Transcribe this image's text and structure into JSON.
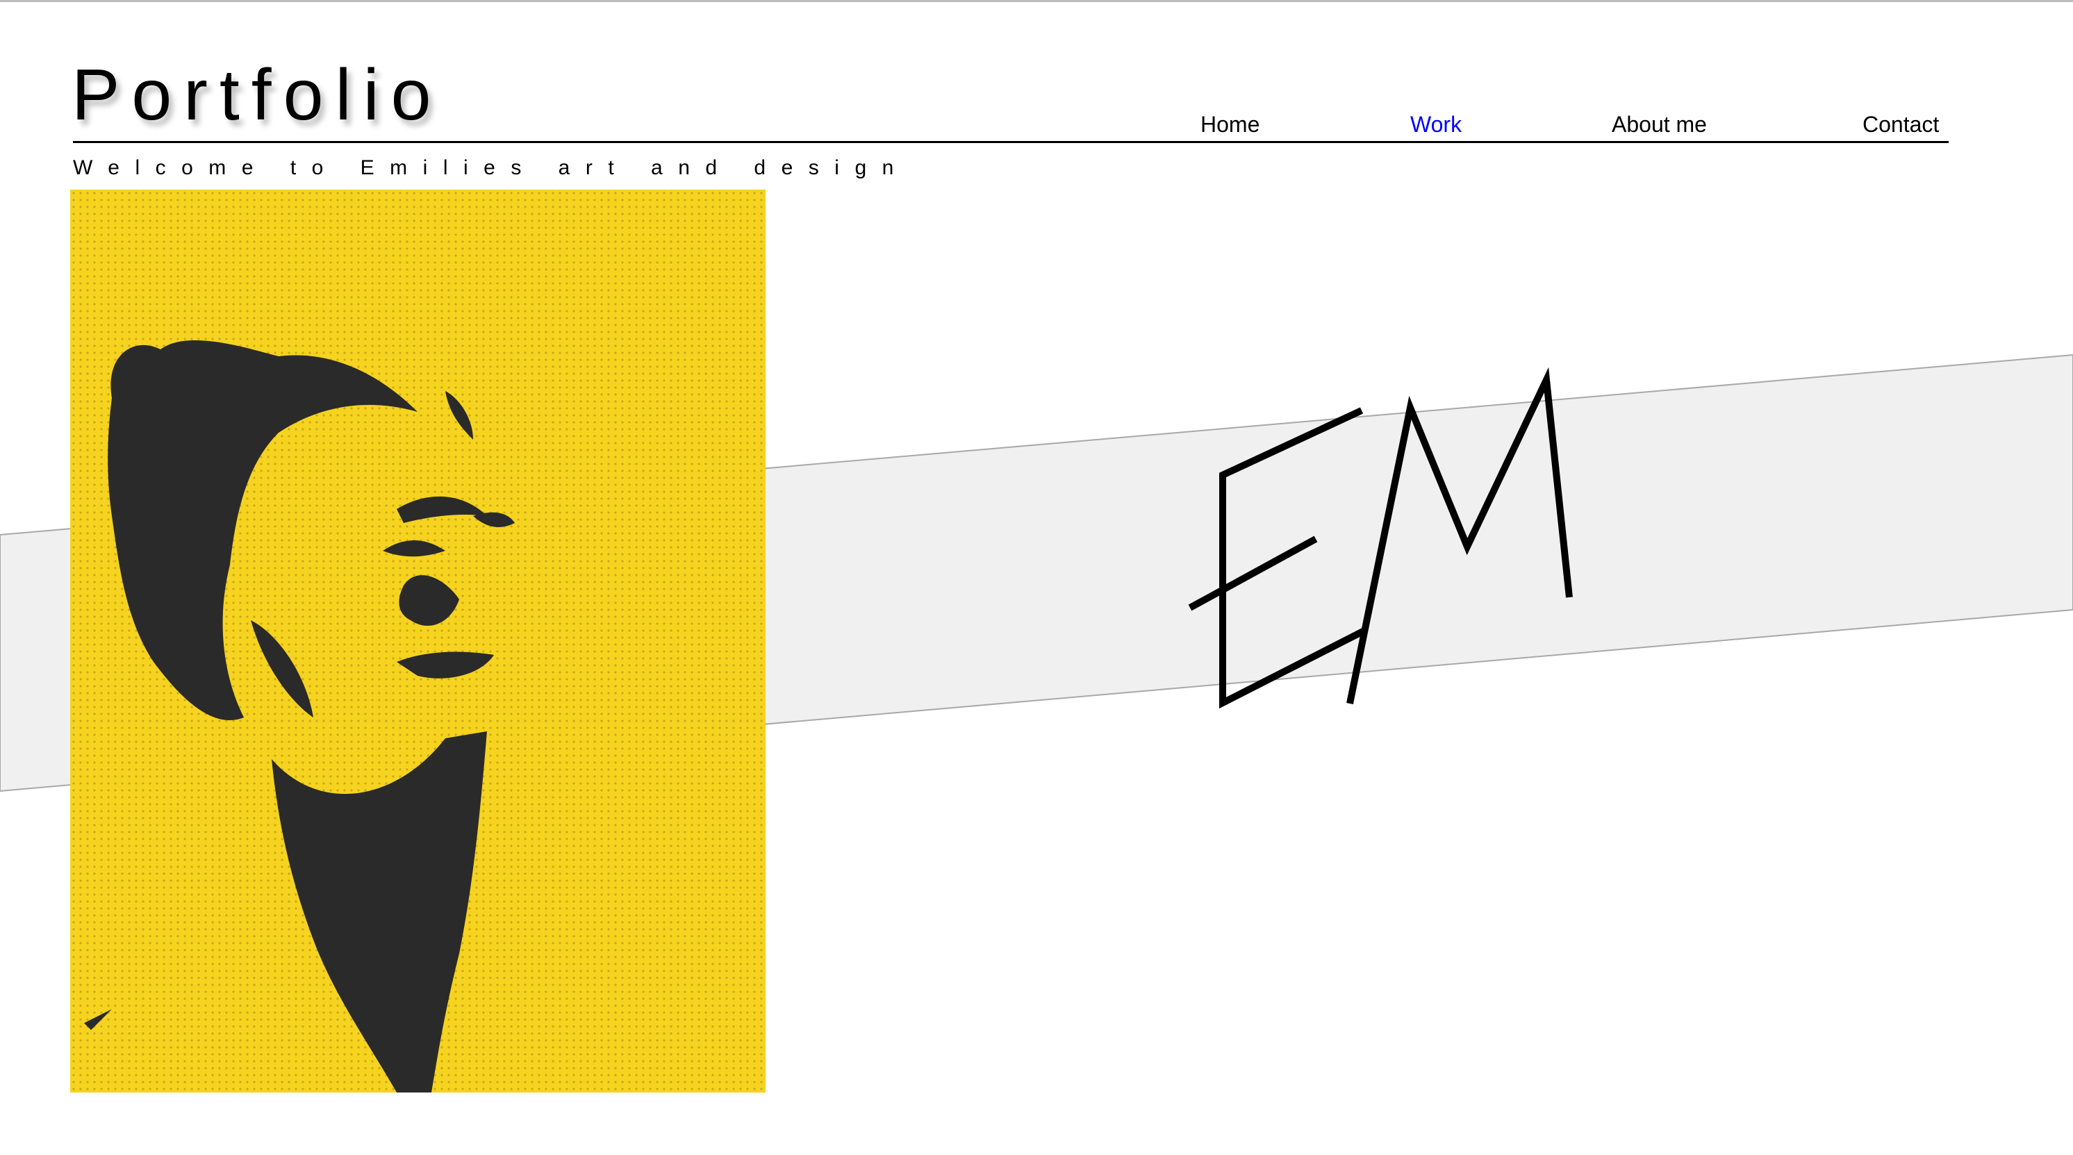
{
  "header": {
    "title": "Portfolio",
    "subtitle": "Welcome to Emilies art and design"
  },
  "nav": {
    "items": [
      {
        "label": "Home",
        "active": false
      },
      {
        "label": "Work",
        "active": true
      },
      {
        "label": "About me",
        "active": false
      },
      {
        "label": "Contact",
        "active": false
      }
    ]
  },
  "colors": {
    "accent_link": "#0000ff",
    "portrait_background": "#f5d31f",
    "band": "#f0f0f0"
  },
  "logo": {
    "text": "EM"
  },
  "portrait": {
    "description_icon": "halftone-portrait-image"
  }
}
